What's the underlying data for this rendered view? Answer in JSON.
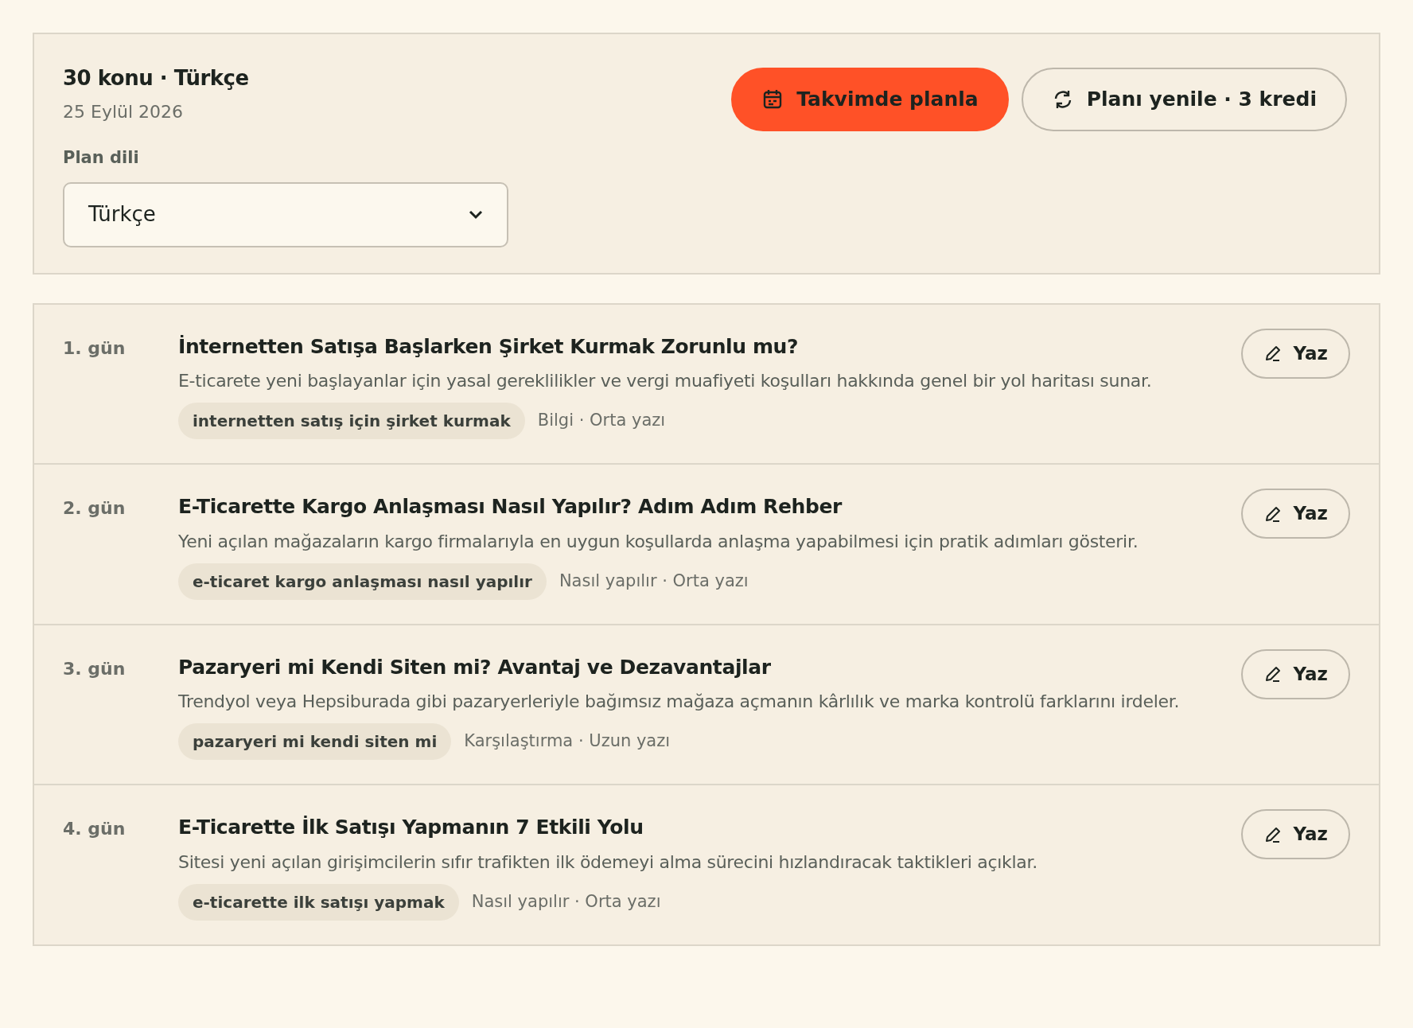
{
  "summary": {
    "title": "30 konu · Türkçe",
    "date": "25 Eylül 2026",
    "language_label": "Plan dili",
    "language_select": {
      "value": "Türkçe"
    }
  },
  "actions": [
    {
      "kind": "schedule",
      "label": "Takvimde planla"
    },
    {
      "kind": "regenerate",
      "label": "Planı yenile · 3 kredi"
    }
  ],
  "topics": [
    {
      "day": "1. gün",
      "title": "İnternetten Satışa Başlarken Şirket Kurmak Zorunlu mu?",
      "description": "E-ticarete yeni başlayanlar için yasal gereklilikler ve vergi muafiyeti koşulları hakkında genel bir yol haritası sunar.",
      "keyword": "internetten satış için şirket kurmak",
      "meta": "Bilgi · Orta yazı",
      "button": "Yaz"
    },
    {
      "day": "2. gün",
      "title": "E-Ticarette Kargo Anlaşması Nasıl Yapılır? Adım Adım Rehber",
      "description": "Yeni açılan mağazaların kargo firmalarıyla en uygun koşullarda anlaşma yapabilmesi için pratik adımları gösterir.",
      "keyword": "e-ticaret kargo anlaşması nasıl yapılır",
      "meta": "Nasıl yapılır · Orta yazı",
      "button": "Yaz"
    },
    {
      "day": "3. gün",
      "title": "Pazaryeri mi Kendi Siten mi? Avantaj ve Dezavantajlar",
      "description": "Trendyol veya Hepsiburada gibi pazaryerleriyle bağımsız mağaza açmanın kârlılık ve marka kontrolü farklarını irdeler.",
      "keyword": "pazaryeri mi kendi siten mi",
      "meta": "Karşılaştırma · Uzun yazı",
      "button": "Yaz"
    },
    {
      "day": "4. gün",
      "title": "E-Ticarette İlk Satışı Yapmanın 7 Etkili Yolu",
      "description": "Sitesi yeni açılan girişimcilerin sıfır trafikten ilk ödemeyi alma sürecini hızlandıracak taktikleri açıklar.",
      "keyword": "e-ticarette ilk satışı yapmak",
      "meta": "Nasıl yapılır · Orta yazı",
      "button": "Yaz"
    }
  ]
}
